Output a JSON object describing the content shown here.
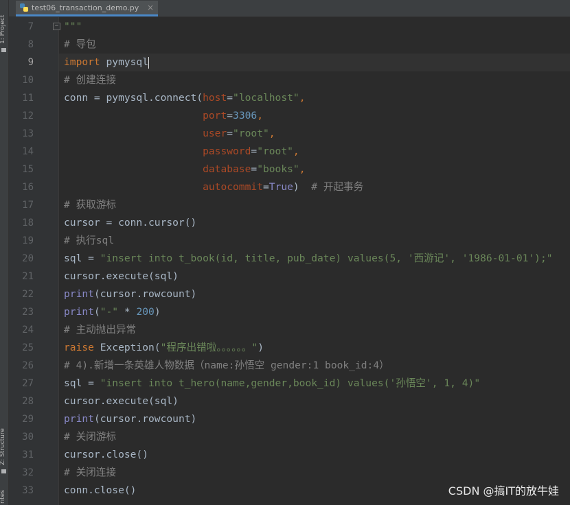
{
  "tab": {
    "filename": "test06_transaction_demo.py",
    "close_glyph": "×"
  },
  "toolstrip": {
    "project": "1: Project",
    "structure": "Z: Structure",
    "favorites": "rites"
  },
  "editor": {
    "active_line": 9,
    "lines": [
      {
        "n": "7",
        "tokens": [
          {
            "t": "\"\"\"",
            "c": "str"
          }
        ]
      },
      {
        "n": "8",
        "tokens": [
          {
            "t": "# 导包",
            "c": "cm"
          }
        ]
      },
      {
        "n": "9",
        "tokens": [
          {
            "t": "import",
            "c": "kw"
          },
          {
            "t": " pymysql",
            "c": ""
          }
        ]
      },
      {
        "n": "10",
        "tokens": [
          {
            "t": "# 创建连接",
            "c": "cm"
          }
        ]
      },
      {
        "n": "11",
        "tokens": [
          {
            "t": "conn = pymysql.connect(",
            "c": ""
          },
          {
            "t": "host",
            "c": "param"
          },
          {
            "t": "=",
            "c": ""
          },
          {
            "t": "\"localhost\"",
            "c": "str"
          },
          {
            "t": ",",
            "c": "kw"
          }
        ]
      },
      {
        "n": "12",
        "tokens": [
          {
            "t": "                       ",
            "c": ""
          },
          {
            "t": "port",
            "c": "param"
          },
          {
            "t": "=",
            "c": ""
          },
          {
            "t": "3306",
            "c": "num"
          },
          {
            "t": ",",
            "c": "kw"
          }
        ]
      },
      {
        "n": "13",
        "tokens": [
          {
            "t": "                       ",
            "c": ""
          },
          {
            "t": "user",
            "c": "param"
          },
          {
            "t": "=",
            "c": ""
          },
          {
            "t": "\"root\"",
            "c": "str"
          },
          {
            "t": ",",
            "c": "kw"
          }
        ]
      },
      {
        "n": "14",
        "tokens": [
          {
            "t": "                       ",
            "c": ""
          },
          {
            "t": "password",
            "c": "param"
          },
          {
            "t": "=",
            "c": ""
          },
          {
            "t": "\"root\"",
            "c": "str"
          },
          {
            "t": ",",
            "c": "kw"
          }
        ]
      },
      {
        "n": "15",
        "tokens": [
          {
            "t": "                       ",
            "c": ""
          },
          {
            "t": "database",
            "c": "param"
          },
          {
            "t": "=",
            "c": ""
          },
          {
            "t": "\"books\"",
            "c": "str"
          },
          {
            "t": ",",
            "c": "kw"
          }
        ]
      },
      {
        "n": "16",
        "tokens": [
          {
            "t": "                       ",
            "c": ""
          },
          {
            "t": "autocommit",
            "c": "param"
          },
          {
            "t": "=",
            "c": ""
          },
          {
            "t": "True",
            "c": "py3"
          },
          {
            "t": ")  ",
            "c": ""
          },
          {
            "t": "# 开起事务",
            "c": "cm"
          }
        ]
      },
      {
        "n": "17",
        "tokens": [
          {
            "t": "# 获取游标",
            "c": "cm"
          }
        ]
      },
      {
        "n": "18",
        "tokens": [
          {
            "t": "cursor = conn.cursor()",
            "c": ""
          }
        ]
      },
      {
        "n": "19",
        "tokens": [
          {
            "t": "# 执行sql",
            "c": "cm"
          }
        ]
      },
      {
        "n": "20",
        "tokens": [
          {
            "t": "sql = ",
            "c": ""
          },
          {
            "t": "\"insert into t_book(id, title, pub_date) values(5, '西游记', '1986-01-01');\"",
            "c": "str"
          }
        ]
      },
      {
        "n": "21",
        "tokens": [
          {
            "t": "cursor.execute(sql)",
            "c": ""
          }
        ]
      },
      {
        "n": "22",
        "tokens": [
          {
            "t": "print",
            "c": "bi"
          },
          {
            "t": "(cursor.rowcount)",
            "c": ""
          }
        ]
      },
      {
        "n": "23",
        "tokens": [
          {
            "t": "print",
            "c": "bi"
          },
          {
            "t": "(",
            "c": ""
          },
          {
            "t": "\"-\"",
            "c": "str"
          },
          {
            "t": " * ",
            "c": ""
          },
          {
            "t": "200",
            "c": "num"
          },
          {
            "t": ")",
            "c": ""
          }
        ]
      },
      {
        "n": "24",
        "tokens": [
          {
            "t": "# 主动抛出异常",
            "c": "cm"
          }
        ]
      },
      {
        "n": "25",
        "tokens": [
          {
            "t": "raise ",
            "c": "kw"
          },
          {
            "t": "Exception(",
            "c": ""
          },
          {
            "t": "\"程序出错啦。。。。。。\"",
            "c": "str"
          },
          {
            "t": ")",
            "c": ""
          }
        ]
      },
      {
        "n": "26",
        "tokens": [
          {
            "t": "# 4).新增一条英雄人物数据（name:孙悟空 gender:1 book_id:4）",
            "c": "cm"
          }
        ]
      },
      {
        "n": "27",
        "tokens": [
          {
            "t": "sql = ",
            "c": ""
          },
          {
            "t": "\"insert into t_hero(name,gender,book_id) values('孙悟空', 1, 4)\"",
            "c": "str"
          }
        ]
      },
      {
        "n": "28",
        "tokens": [
          {
            "t": "cursor.execute(sql)",
            "c": ""
          }
        ]
      },
      {
        "n": "29",
        "tokens": [
          {
            "t": "print",
            "c": "bi"
          },
          {
            "t": "(cursor.rowcount)",
            "c": ""
          }
        ]
      },
      {
        "n": "30",
        "tokens": [
          {
            "t": "# 关闭游标",
            "c": "cm"
          }
        ]
      },
      {
        "n": "31",
        "tokens": [
          {
            "t": "cursor.close()",
            "c": ""
          }
        ]
      },
      {
        "n": "32",
        "tokens": [
          {
            "t": "# 关闭连接",
            "c": "cm"
          }
        ]
      },
      {
        "n": "33",
        "tokens": [
          {
            "t": "conn.close()",
            "c": ""
          }
        ]
      }
    ]
  },
  "watermark": "CSDN @搞IT的放牛娃",
  "colors": {
    "background": "#2b2b2b",
    "gutter": "#313335",
    "keyword": "#cc7832",
    "string": "#6a8759",
    "comment": "#808080",
    "number": "#6897bb",
    "param": "#aa4926",
    "builtin": "#8888c6"
  }
}
